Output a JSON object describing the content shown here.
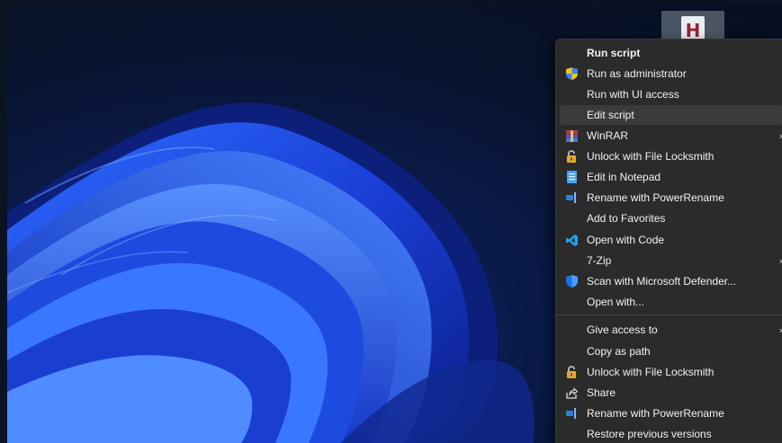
{
  "context_menu": {
    "items": [
      {
        "label": "Run script",
        "icon": "",
        "bold": true
      },
      {
        "label": "Run as administrator",
        "icon": "shield-icon"
      },
      {
        "label": "Run with UI access",
        "icon": ""
      },
      {
        "label": "Edit script",
        "icon": "",
        "highlighted": true
      },
      {
        "label": "WinRAR",
        "icon": "winrar-icon",
        "submenu": true
      },
      {
        "label": "Unlock with File Locksmith",
        "icon": "lock-icon"
      },
      {
        "label": "Edit in Notepad",
        "icon": "notepad-icon"
      },
      {
        "label": "Rename with PowerRename",
        "icon": "powerrename-icon"
      },
      {
        "label": "Add to Favorites",
        "icon": ""
      },
      {
        "label": "Open with Code",
        "icon": "vscode-icon"
      },
      {
        "label": "7-Zip",
        "icon": "",
        "submenu": true
      },
      {
        "label": "Scan with Microsoft Defender...",
        "icon": "defender-icon"
      },
      {
        "label": "Open with...",
        "icon": ""
      },
      {
        "label": "Give access to",
        "icon": "",
        "submenu": true
      },
      {
        "label": "Copy as path",
        "icon": ""
      },
      {
        "label": "Unlock with File Locksmith",
        "icon": "lock-icon"
      },
      {
        "label": "Share",
        "icon": "share-icon"
      },
      {
        "label": "Rename with PowerRename",
        "icon": "powerrename-icon"
      },
      {
        "label": "Restore previous versions",
        "icon": ""
      }
    ]
  },
  "desktop_file": {
    "icon": "ahk-file-icon",
    "glyph": "H"
  },
  "colors": {
    "menu_bg": "#2b2b2b",
    "menu_highlight": "#3b3b3b",
    "menu_text": "#f2f2f2",
    "shield_yellow": "#f5c518",
    "shield_blue": "#3b82f6",
    "vscode_blue": "#22a0f0",
    "defender_blue": "#1a73e8",
    "file_glyph": "#9b2335"
  }
}
